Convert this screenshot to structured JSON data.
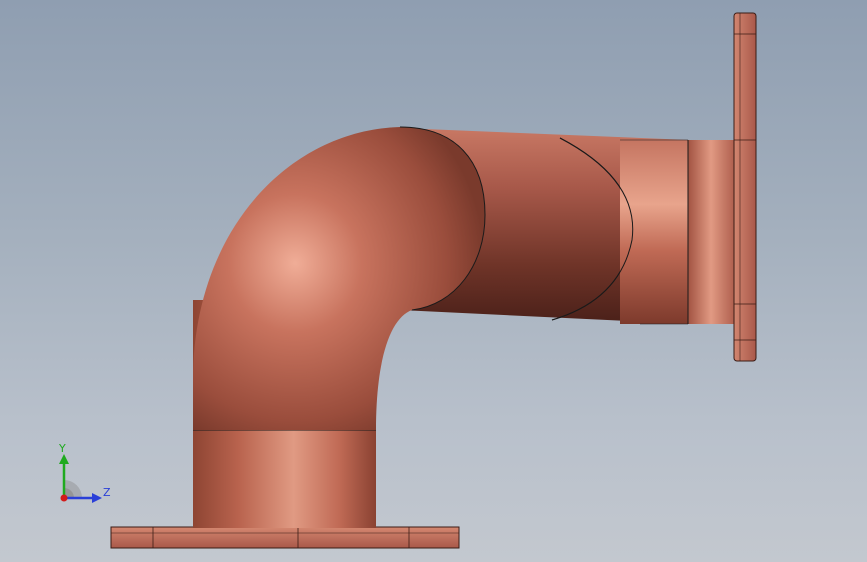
{
  "viewport": {
    "background_top": "#8f9eb1",
    "background_bottom": "#c3c8cf"
  },
  "model": {
    "part_color": "#c06a55",
    "edge_color": "#1a1a1a",
    "shape": "90-degree pipe elbow with square flanges at both ends"
  },
  "triad": {
    "y_label": "Y",
    "z_label": "Z",
    "y_color": "#1faa1f",
    "z_color": "#2a3fd8",
    "x_color": "#d21a1a"
  }
}
